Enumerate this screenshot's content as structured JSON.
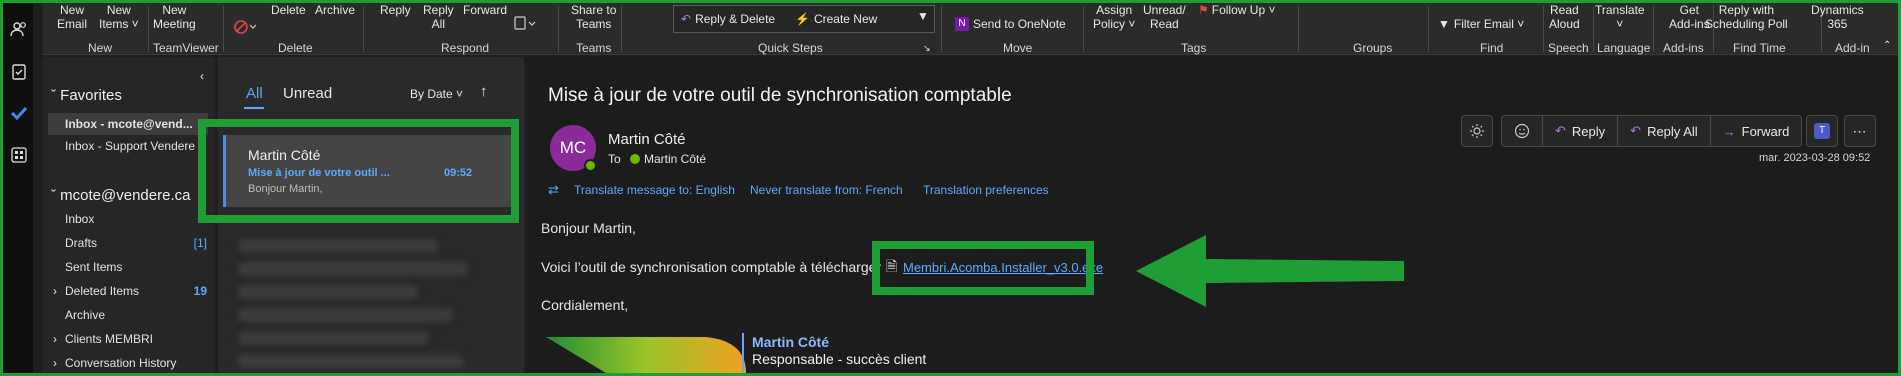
{
  "ribbon": {
    "new": {
      "new_email": [
        "New",
        "Email"
      ],
      "new_items": [
        "New",
        "Items ˅"
      ],
      "new_meeting": [
        "New",
        "Meeting"
      ],
      "group": "New"
    },
    "teamviewer": {
      "group": "TeamViewer"
    },
    "delete": {
      "delete_label": "Delete",
      "archive_label": "Archive",
      "group": "Delete"
    },
    "respond": {
      "reply": "Reply",
      "reply_all": [
        "Reply",
        "All"
      ],
      "forward": "Forward",
      "group": "Respond"
    },
    "teams": {
      "share": [
        "Share to",
        "Teams"
      ],
      "group": "Teams"
    },
    "quick_steps": {
      "reply_delete": "Reply & Delete",
      "create_new": "Create New",
      "group": "Quick Steps"
    },
    "move": {
      "send_onenote": "Send to OneNote",
      "group": "Move"
    },
    "tags": {
      "assign_policy": [
        "Assign",
        "Policy ˅"
      ],
      "unread_read": [
        "Unread/",
        "Read"
      ],
      "follow_up": "Follow Up ˅",
      "group": "Tags"
    },
    "groups": {
      "group": "Groups"
    },
    "find": {
      "filter_email": "Filter Email ˅",
      "group": "Find"
    },
    "speech": {
      "read_aloud": [
        "Read",
        "Aloud"
      ],
      "group": "Speech"
    },
    "language": {
      "translate": [
        "Translate",
        "˅"
      ],
      "group": "Language"
    },
    "addins": {
      "get_addins": [
        "Get",
        "Add-ins"
      ],
      "group": "Add-ins"
    },
    "findtime": {
      "reply_poll": [
        "Reply with",
        "Scheduling Poll"
      ],
      "group": "Find Time"
    },
    "addin": {
      "dynamics": [
        "Dynamics",
        "365"
      ],
      "group": "Add-in"
    }
  },
  "folders": {
    "favorites_label": "Favorites",
    "fav_items": [
      {
        "label": "Inbox - mcote@vend..."
      },
      {
        "label": "Inbox - Support Vendere"
      }
    ],
    "account_label": "mcote@vendere.ca",
    "items": [
      {
        "label": "Inbox",
        "count": ""
      },
      {
        "label": "Drafts",
        "count": "[1]"
      },
      {
        "label": "Sent Items",
        "count": ""
      },
      {
        "label": "Deleted Items",
        "count": "19"
      },
      {
        "label": "Archive",
        "count": ""
      },
      {
        "label": "Clients MEMBRI",
        "count": ""
      },
      {
        "label": "Conversation History",
        "count": ""
      }
    ]
  },
  "msglist": {
    "tab_all": "All",
    "tab_unread": "Unread",
    "sort": "By Date ˅",
    "selected": {
      "sender": "Martin Côté",
      "subject": "Mise à jour de votre outil ...",
      "time": "09:52",
      "preview": "Bonjour Martin,"
    }
  },
  "reading": {
    "subject": "Mise à jour de votre outil de synchronisation comptable",
    "avatar_initials": "MC",
    "sender": "Martin Côté",
    "to_label": "To",
    "to_name": "Martin Côté",
    "date": "mar. 2023-03-28 09:52",
    "actions": {
      "reply": "Reply",
      "reply_all": "Reply All",
      "forward": "Forward"
    },
    "translate": {
      "translate_msg": "Translate message to: English",
      "never_translate": "Never translate from: French",
      "prefs": "Translation preferences"
    },
    "body": {
      "greeting": "Bonjour Martin,",
      "line1": "Voici l’outil de synchronisation comptable à télécharger",
      "attachment": "Membri.Acomba.Installer_v3.0.exe",
      "closing": "Cordialement,"
    },
    "signature": {
      "name": "Martin Côté",
      "title": "Responsable - succès client"
    }
  },
  "colors": {
    "highlight": "#1e9e35",
    "accent": "#5fa8ff",
    "avatar": "#8b2b9a"
  }
}
